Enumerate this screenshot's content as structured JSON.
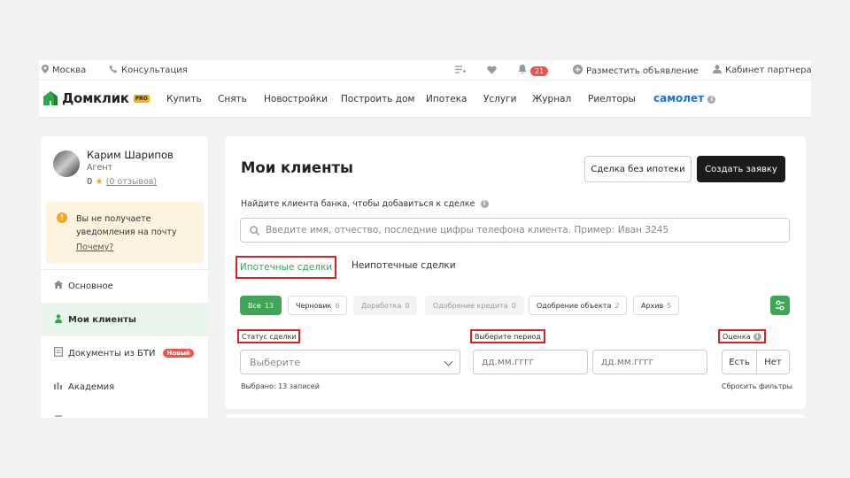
{
  "topbar": {
    "city": "Москва",
    "consultation": "Консультация",
    "notifications_count": "21",
    "post_ad": "Разместить объявление",
    "partner_cabinet": "Кабинет партнера"
  },
  "nav": {
    "logo_text": "Домклик",
    "logo_badge": "PRO",
    "links": [
      "Купить",
      "Снять",
      "Новостройки",
      "Построить дом",
      "Ипотека",
      "Услуги",
      "Журнал",
      "Риелторы"
    ],
    "samolet": "самолет"
  },
  "sidebar": {
    "user_name": "Карим Шарипов",
    "user_role": "Агент",
    "rating": "0",
    "reviews": "(0 отзывов)",
    "warning_text": "Вы не получаете уведомления на почту",
    "warning_link": "Почему?",
    "items": [
      {
        "label": "Основное",
        "icon": "home-icon"
      },
      {
        "label": "Мои клиенты",
        "icon": "person-icon"
      },
      {
        "label": "Документы из БТИ",
        "icon": "document-icon",
        "badge": "Новый"
      },
      {
        "label": "Академия",
        "icon": "academy-icon"
      }
    ]
  },
  "main": {
    "title": "Мои клиенты",
    "btn_no_mortgage": "Сделка без ипотеки",
    "btn_create": "Создать заявку",
    "find_label": "Найдите клиента банка, чтобы добавиться к сделке",
    "search_placeholder": "Введите имя, отчество, последние цифры телефона клиента. Пример: Иван 3245",
    "tabs": [
      "Ипотечные сделки",
      "Неипотечные сделки"
    ],
    "chips": [
      {
        "label": "Все",
        "count": "13"
      },
      {
        "label": "Черновик",
        "count": "6"
      },
      {
        "label": "Доработка",
        "count": "0"
      },
      {
        "label": "Одобрение кредита",
        "count": "0"
      },
      {
        "label": "Одобрение объекта",
        "count": "2"
      },
      {
        "label": "Архив",
        "count": "5"
      }
    ],
    "status_label": "Статус сделки",
    "period_label": "Выберите период",
    "rating_label": "Оценка",
    "select_placeholder": "Выберите",
    "date_placeholder": "дд.мм.гггг",
    "yes": "Есть",
    "no": "Нет",
    "selected_count": "Выбрано: 13 записей",
    "reset_filters": "Сбросить фильтры"
  },
  "colors": {
    "accent_green": "#3fa655",
    "highlight_red": "#e02020",
    "brand_blue": "#1e6fe0",
    "badge_red": "#ef5350"
  }
}
